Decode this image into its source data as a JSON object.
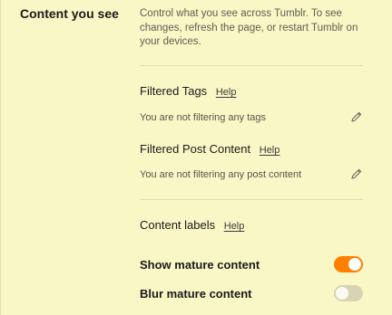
{
  "section": {
    "title": "Content you see",
    "description": "Control what you see across Tumblr. To see changes, refresh the page, or restart Tumblr on your devices."
  },
  "filtered_tags": {
    "heading": "Filtered Tags",
    "help": "Help",
    "status": "You are not filtering any tags",
    "edit_icon": "pencil-icon"
  },
  "filtered_post_content": {
    "heading": "Filtered Post Content",
    "help": "Help",
    "status": "You are not filtering any post content",
    "edit_icon": "pencil-icon"
  },
  "content_labels": {
    "heading": "Content labels",
    "help": "Help"
  },
  "toggles": [
    {
      "label": "Show mature content",
      "on": true
    },
    {
      "label": "Blur mature content",
      "on": false
    }
  ],
  "colors": {
    "background": "#faf7c6",
    "accent": "#ff7f00",
    "toggle_off": "#d6d4b3"
  }
}
